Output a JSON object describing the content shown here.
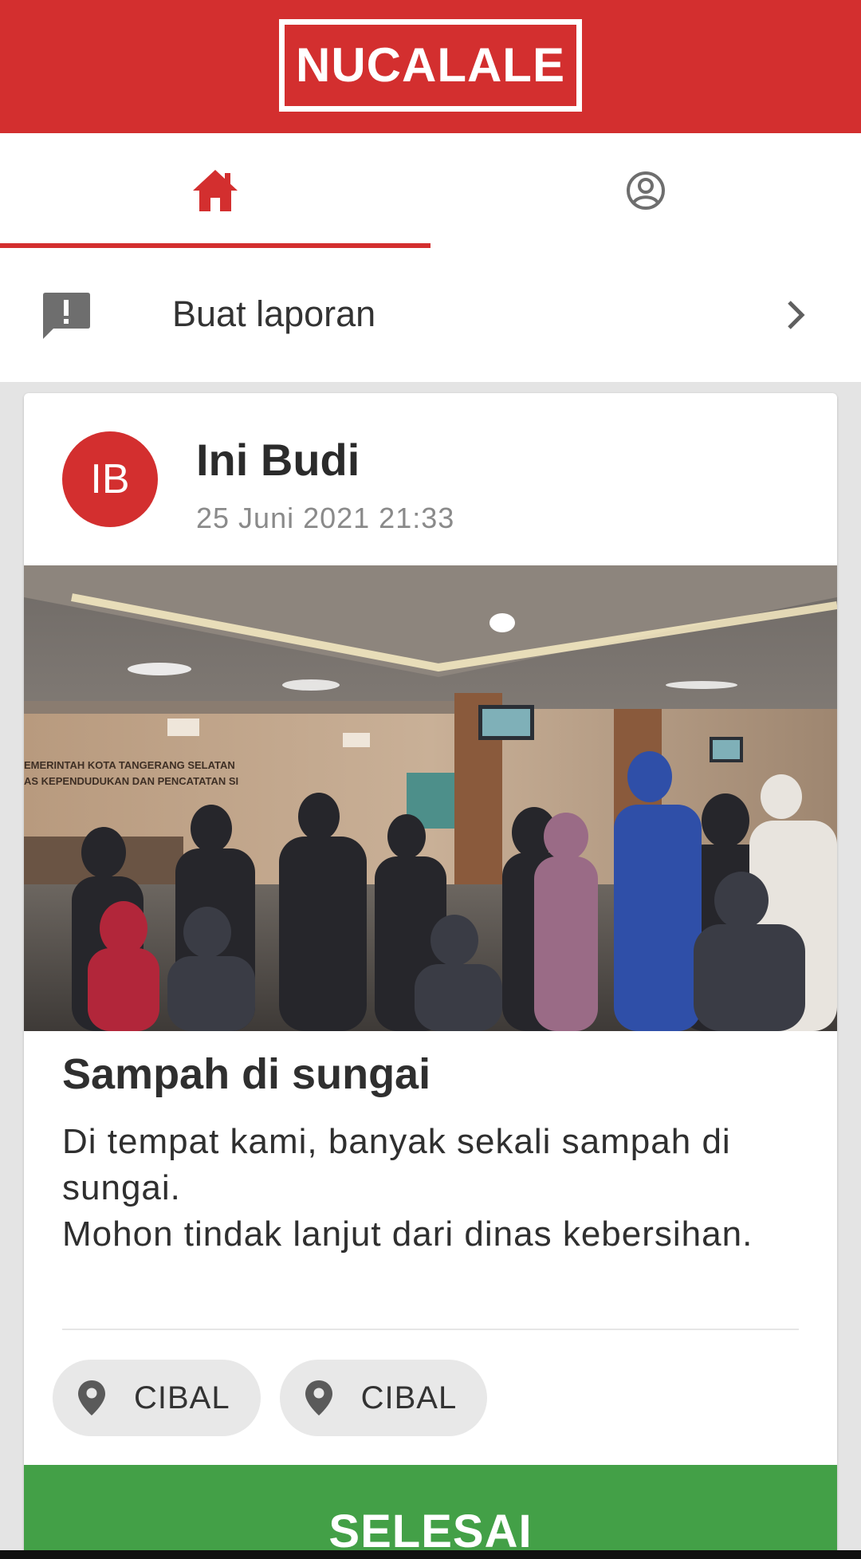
{
  "header": {
    "logo_text": "NUCALALE"
  },
  "tabs": {
    "home_icon": "home-icon",
    "profile_icon": "account-circle-icon",
    "active": "home"
  },
  "report_row": {
    "icon": "report-icon",
    "label": "Buat laporan",
    "chevron": "chevron-right-icon"
  },
  "post": {
    "avatar_initials": "IB",
    "author": "Ini Budi",
    "date": "25 Juni 2021 21:33",
    "title": "Sampah di sungai",
    "body": [
      "Di tempat kami, banyak sekali sampah di sungai.",
      "Mohon tindak lanjut dari dinas kebersihan."
    ],
    "locations": [
      {
        "icon": "map-pin-icon",
        "label": "CIBAL"
      },
      {
        "icon": "map-pin-icon",
        "label": "CIBAL"
      }
    ],
    "status_button": "SELESAI"
  },
  "colors": {
    "brand_red": "#d32f2f",
    "success_green": "#43a047",
    "background": "#e4e4e4"
  }
}
